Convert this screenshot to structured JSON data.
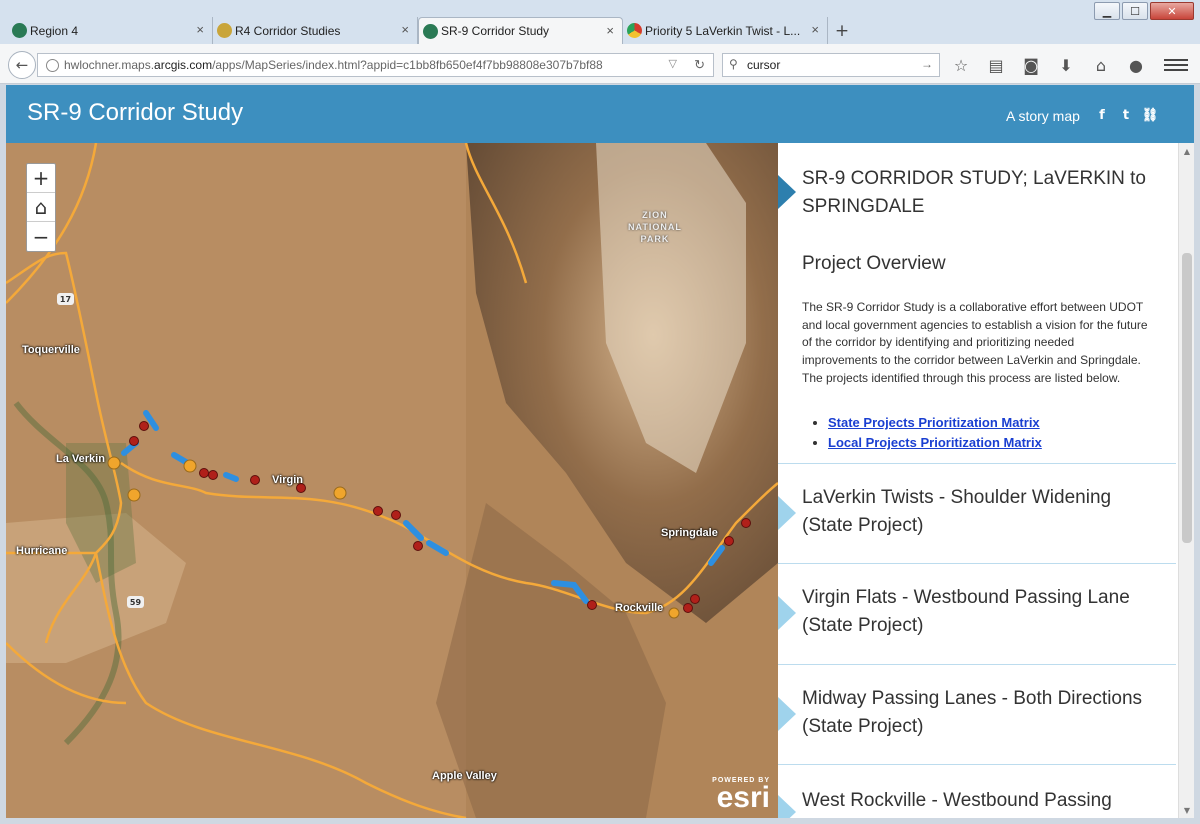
{
  "browser": {
    "tabs": [
      {
        "label": "Region 4",
        "fav": "#2a7a55"
      },
      {
        "label": "R4 Corridor Studies",
        "fav": "#c9a53a"
      },
      {
        "label": "SR-9 Corridor Study",
        "fav": "#2a7a55"
      },
      {
        "label": "Priority 5 LaVerkin Twist - L...",
        "fav": "#d33b2c"
      }
    ],
    "new_tab": "+",
    "close_glyph": "×",
    "url_prefix": "hwlochner.maps.",
    "url_host": "arcgis.com",
    "url_path": "/apps/MapSeries/index.html?appid=c1bb8fb650ef4f7bb98808e307b7bf88",
    "search_value": "cursor"
  },
  "header": {
    "title": "SR-9 Corridor Study",
    "story_label": "A story map"
  },
  "map": {
    "zoom_in": "+",
    "zoom_out": "−",
    "places": [
      {
        "name": "Toquerville"
      },
      {
        "name": "La Verkin"
      },
      {
        "name": "Virgin"
      },
      {
        "name": "Hurricane"
      },
      {
        "name": "Springdale"
      },
      {
        "name": "Rockville"
      },
      {
        "name": "Apple Valley"
      }
    ],
    "park_label_1": "ZION",
    "park_label_2": "NATIONAL",
    "park_label_3": "PARK",
    "shield_17": "17",
    "shield_59": "59",
    "esri_powered": "POWERED BY",
    "esri_name": "esri"
  },
  "panel": {
    "entries": [
      {
        "title": "SR-9 CORRIDOR STUDY; LaVERKIN to SPRINGDALE"
      },
      {
        "title": "LaVerkin Twists - Shoulder Widening (State Project)"
      },
      {
        "title": "Virgin Flats - Westbound Passing Lane (State Project)"
      },
      {
        "title": "Midway Passing Lanes - Both Directions (State Project)"
      },
      {
        "title": "West Rockville - Westbound Passing"
      }
    ],
    "overview_heading": "Project Overview",
    "overview_text": "The SR-9 Corridor Study is a collaborative effort between UDOT and local government agencies to establish a vision for the future of the corridor by identifying and prioritizing needed improvements to the corridor between LaVerkin and Springdale. The projects identified through this process are listed below.",
    "links": [
      {
        "label": "State Projects Prioritization Matrix"
      },
      {
        "label": "Local Projects Prioritization Matrix"
      }
    ]
  },
  "colors": {
    "header_bg": "#3d8fbf",
    "active_marker": "#2d7fae",
    "inactive_marker": "#9fd3ec",
    "link": "#1a3fd1",
    "road": "#f4a93a",
    "project_blue": "#2e8fe0",
    "project_red": "#b0201a"
  }
}
